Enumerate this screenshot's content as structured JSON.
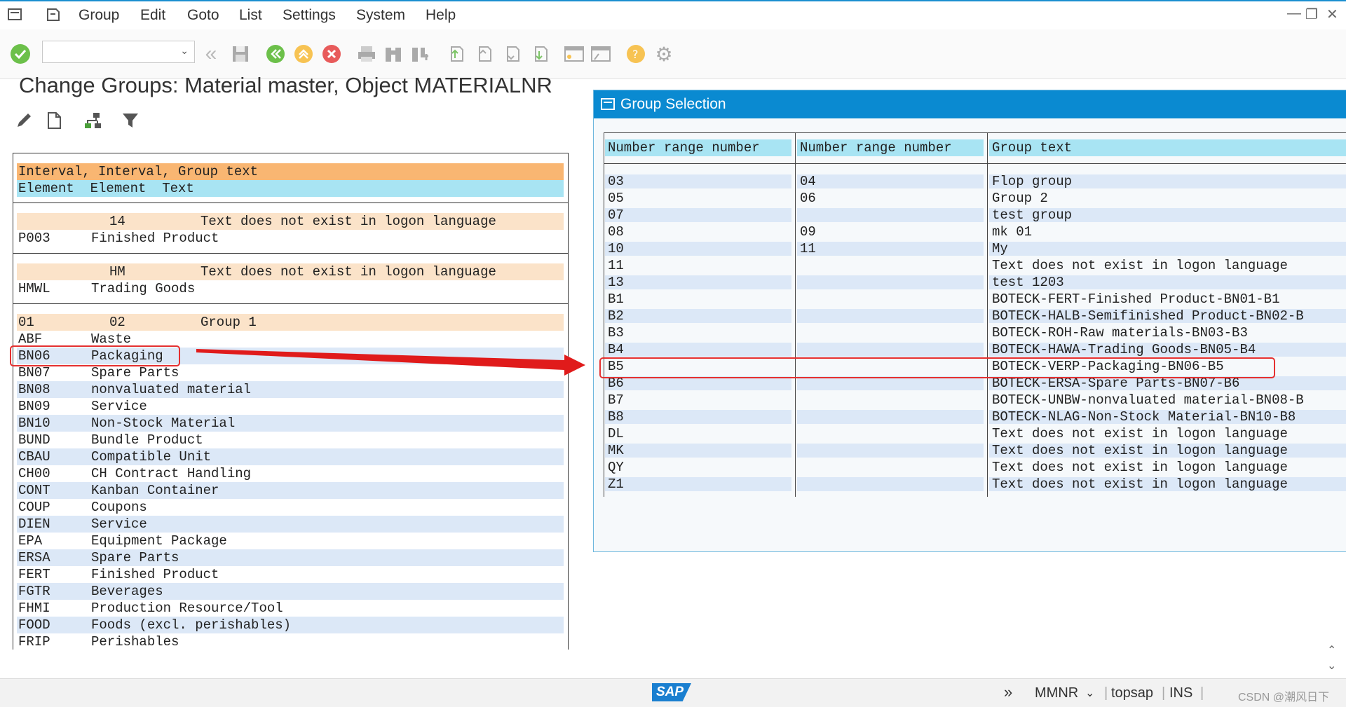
{
  "menubar": {
    "items": [
      "Group",
      "Edit",
      "Goto",
      "List",
      "Settings",
      "System",
      "Help"
    ]
  },
  "title": "Change Groups: Material master, Object MATERIALNR",
  "left_list": {
    "header1": "Interval, Interval, Group text",
    "header2": "Element  Element  Text",
    "group1": {
      "from": "",
      "to": "14",
      "text": "Text does not exist in logon language",
      "rows": [
        {
          "code": "P003",
          "text": "Finished Product"
        }
      ]
    },
    "group2": {
      "from": "",
      "to": "HM",
      "text": "Text does not exist in logon language",
      "rows": [
        {
          "code": "HMWL",
          "text": "Trading Goods"
        }
      ]
    },
    "group3": {
      "from": "01",
      "to": "02",
      "text": "Group 1",
      "rows": [
        {
          "code": "ABF",
          "text": "Waste"
        },
        {
          "code": "BN06",
          "text": "Packaging"
        },
        {
          "code": "BN07",
          "text": "Spare Parts"
        },
        {
          "code": "BN08",
          "text": "nonvaluated material"
        },
        {
          "code": "BN09",
          "text": "Service"
        },
        {
          "code": "BN10",
          "text": "Non-Stock Material"
        },
        {
          "code": "BUND",
          "text": "Bundle Product"
        },
        {
          "code": "CBAU",
          "text": "Compatible Unit"
        },
        {
          "code": "CH00",
          "text": "CH Contract Handling"
        },
        {
          "code": "CONT",
          "text": "Kanban Container"
        },
        {
          "code": "COUP",
          "text": "Coupons"
        },
        {
          "code": "DIEN",
          "text": "Service"
        },
        {
          "code": "EPA",
          "text": "Equipment Package"
        },
        {
          "code": "ERSA",
          "text": "Spare Parts"
        },
        {
          "code": "FERT",
          "text": "Finished Product"
        },
        {
          "code": "FGTR",
          "text": "Beverages"
        },
        {
          "code": "FHMI",
          "text": "Production Resource/Tool"
        },
        {
          "code": "FOOD",
          "text": "Foods (excl. perishables)"
        },
        {
          "code": "FRIP",
          "text": "Perishables"
        }
      ]
    }
  },
  "popup": {
    "title": "Group Selection",
    "headers": [
      "Number range number",
      "Number range number",
      "Group text"
    ],
    "rows": [
      {
        "from": "03",
        "to": "04",
        "text": "Flop group"
      },
      {
        "from": "05",
        "to": "06",
        "text": "Group 2"
      },
      {
        "from": "07",
        "to": "",
        "text": "test group"
      },
      {
        "from": "08",
        "to": "09",
        "text": "mk 01"
      },
      {
        "from": "10",
        "to": "11",
        "text": "My"
      },
      {
        "from": "11",
        "to": "",
        "text": "Text does not exist in logon language"
      },
      {
        "from": "13",
        "to": "",
        "text": "test 1203"
      },
      {
        "from": "B1",
        "to": "",
        "text": "BOTECK-FERT-Finished Product-BN01-B1"
      },
      {
        "from": "B2",
        "to": "",
        "text": "BOTECK-HALB-Semifinished Product-BN02-B"
      },
      {
        "from": "B3",
        "to": "",
        "text": "BOTECK-ROH-Raw materials-BN03-B3"
      },
      {
        "from": "B4",
        "to": "",
        "text": "BOTECK-HAWA-Trading Goods-BN05-B4"
      },
      {
        "from": "B5",
        "to": "",
        "text": "BOTECK-VERP-Packaging-BN06-B5"
      },
      {
        "from": "B6",
        "to": "",
        "text": "BOTECK-ERSA-Spare Parts-BN07-B6"
      },
      {
        "from": "B7",
        "to": "",
        "text": "BOTECK-UNBW-nonvaluated material-BN08-B"
      },
      {
        "from": "B8",
        "to": "",
        "text": "BOTECK-NLAG-Non-Stock Material-BN10-B8"
      },
      {
        "from": "DL",
        "to": "",
        "text": "Text does not exist in logon language"
      },
      {
        "from": "MK",
        "to": "",
        "text": "Text does not exist in logon language"
      },
      {
        "from": "QY",
        "to": "",
        "text": "Text does not exist in logon language"
      },
      {
        "from": "Z1",
        "to": "",
        "text": "Text does not exist in logon language"
      }
    ]
  },
  "statusbar": {
    "logo": "SAP",
    "transaction": "MMNR",
    "server": "topsap",
    "mode": "INS",
    "watermark": "CSDN @潮风日下"
  },
  "colors": {
    "accent": "#0a8ad1",
    "highlight": "#e53030",
    "header_orange": "#f9b672",
    "header_blue": "#a8e4f3"
  }
}
